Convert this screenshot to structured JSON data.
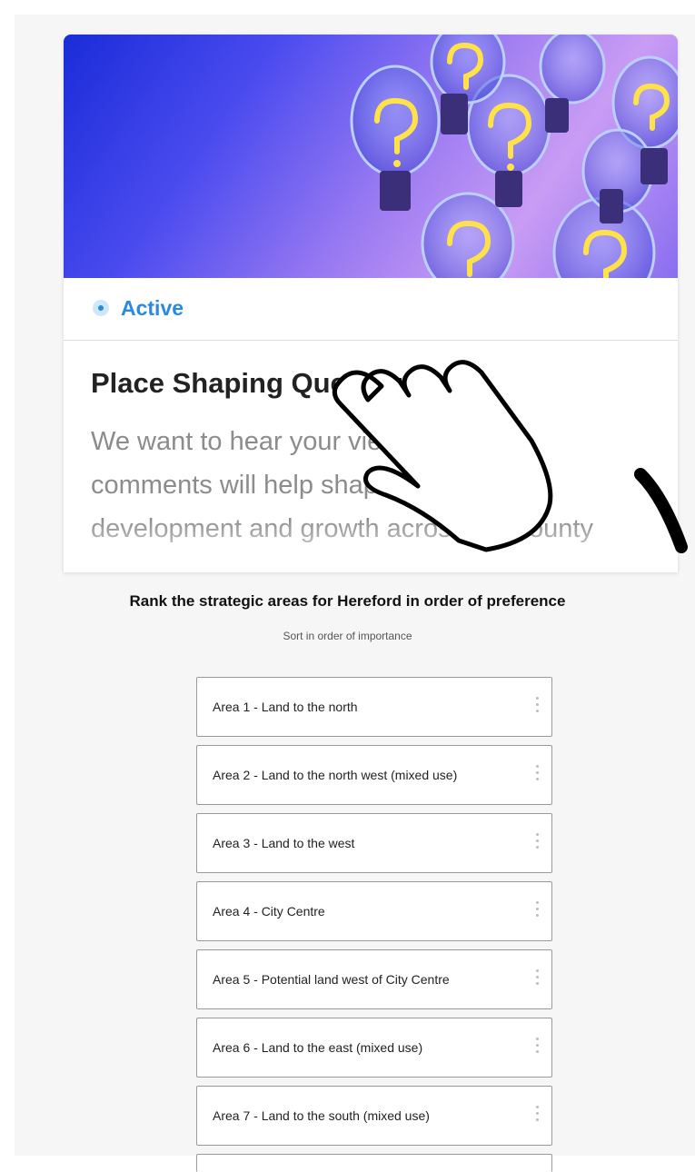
{
  "card": {
    "status": "Active",
    "title": "Place Shaping Questions",
    "description": "We want to hear your views. Your comments will help shape plans for development and growth across the county",
    "hero_image": "lightbulbs-with-question-marks"
  },
  "question": {
    "title": "Rank the strategic areas for Hereford in order of preference",
    "subtitle": "Sort in order of importance",
    "items": [
      {
        "label": "Area 1 - Land to the north"
      },
      {
        "label": "Area 2 - Land to the north west (mixed use)"
      },
      {
        "label": "Area 3 - Land to the west"
      },
      {
        "label": "Area 4 - City Centre"
      },
      {
        "label": "Area 5 - Potential land west of City Centre"
      },
      {
        "label": "Area 6 - Land to the east (mixed use)"
      },
      {
        "label": "Area 7 - Land to the south (mixed use)"
      }
    ]
  },
  "colors": {
    "accent": "#2a8ae0",
    "title": "#222222",
    "muted": "#8c8c8c"
  },
  "icons": {
    "drag_handle": "vertical-dots-icon",
    "status": "active-dot-icon",
    "overlay": "pointing-hand-icon"
  }
}
